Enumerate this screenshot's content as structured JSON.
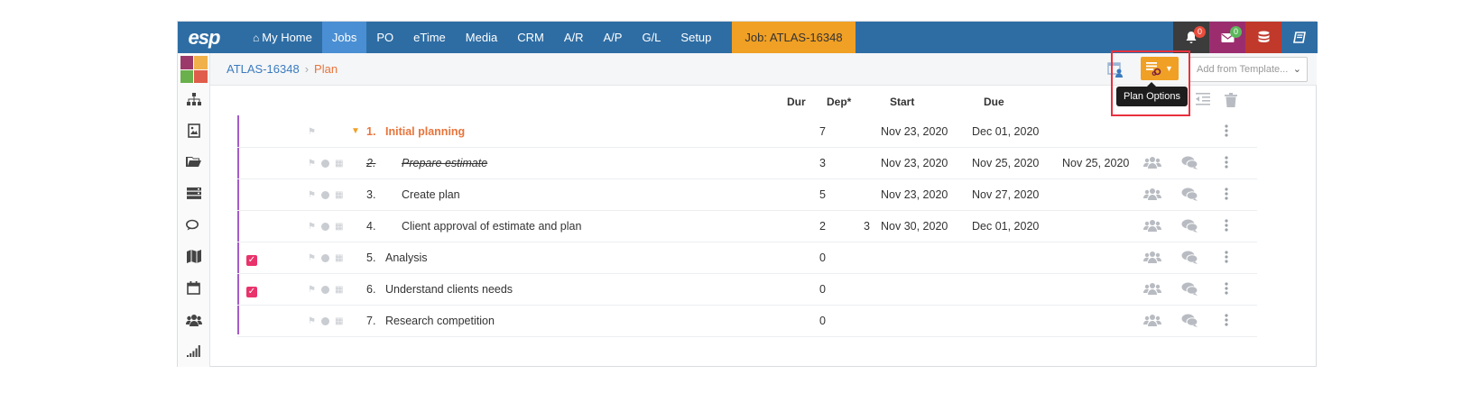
{
  "colors": {
    "nav_bg": "#2e6da4",
    "active_nav": "#4a8fd4",
    "job_tab": "#f0a024",
    "accent_orange": "#e8743b",
    "task_bar": "#a45bc9",
    "check": "#e8336c",
    "highlight": "#e8313e"
  },
  "nav": {
    "logo": "esp",
    "items": [
      {
        "label": "My Home",
        "icon": "home-icon"
      },
      {
        "label": "Jobs",
        "active": true
      },
      {
        "label": "PO"
      },
      {
        "label": "eTime"
      },
      {
        "label": "Media"
      },
      {
        "label": "CRM"
      },
      {
        "label": "A/R"
      },
      {
        "label": "A/P"
      },
      {
        "label": "G/L"
      },
      {
        "label": "Setup"
      }
    ],
    "job_tab": "Job: ATLAS-16348",
    "notifications_count": "0",
    "messages_count": "0"
  },
  "sidebar": {
    "icons": [
      "sitemap-icon",
      "image-icon",
      "folder-icon",
      "server-icon",
      "comments-icon",
      "map-icon",
      "calendar-icon",
      "users-icon",
      "signal-icon"
    ]
  },
  "breadcrumb": {
    "parent": "ATLAS-16348",
    "current": "Plan"
  },
  "toolbar": {
    "tooltip": "Plan Options",
    "template_placeholder": "Add from Template..."
  },
  "table": {
    "headers": {
      "dur": "Dur",
      "dep": "Dep*",
      "start": "Start",
      "due": "Due"
    },
    "rows": [
      {
        "num": "1.",
        "name": "Initial planning",
        "dur": "7",
        "dep": "",
        "start": "Nov 23, 2020",
        "due": "Dec 01, 2020",
        "done": "",
        "type": "group"
      },
      {
        "num": "2.",
        "name": "Prepare estimate",
        "dur": "3",
        "dep": "",
        "start": "Nov 23, 2020",
        "due": "Nov 25, 2020",
        "done": "Nov 25, 2020",
        "type": "completed"
      },
      {
        "num": "3.",
        "name": "Create plan",
        "dur": "5",
        "dep": "",
        "start": "Nov 23, 2020",
        "due": "Nov 27, 2020",
        "done": "",
        "type": "sub"
      },
      {
        "num": "4.",
        "name": "Client approval of estimate and plan",
        "dur": "2",
        "dep": "3",
        "start": "Nov 30, 2020",
        "due": "Dec 01, 2020",
        "done": "",
        "type": "sub"
      },
      {
        "num": "5.",
        "name": "Analysis",
        "dur": "0",
        "dep": "",
        "start": "",
        "due": "",
        "done": "",
        "type": "top",
        "checked": true
      },
      {
        "num": "6.",
        "name": "Understand clients needs",
        "dur": "0",
        "dep": "",
        "start": "",
        "due": "",
        "done": "",
        "type": "top",
        "checked": true
      },
      {
        "num": "7.",
        "name": "Research competition",
        "dur": "0",
        "dep": "",
        "start": "",
        "due": "",
        "done": "",
        "type": "top",
        "checked": false
      }
    ]
  }
}
